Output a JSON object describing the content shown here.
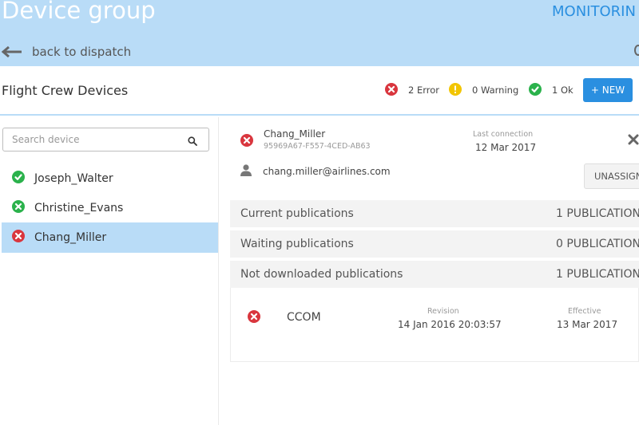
{
  "header": {
    "title": "Device group",
    "monitoring_label": "MONITORIN",
    "back_label": "back to dispatch"
  },
  "subheader": {
    "group_name": "Flight Crew Devices",
    "status": {
      "error_label": "2 Error",
      "warning_label": "0 Warning",
      "ok_label": "1 Ok"
    },
    "new_button_label": "+ NEW"
  },
  "search": {
    "placeholder": "Search device",
    "value": ""
  },
  "devices": [
    {
      "name": "Joseph_Walter",
      "status": "ok"
    },
    {
      "name": "Christine_Evans",
      "status": "ok"
    },
    {
      "name": "Chang_Miller",
      "status": "error"
    }
  ],
  "selected_device": {
    "name": "Chang_Miller",
    "id": "95969A67-F557-4CED-AB63",
    "last_connection_label": "Last connection",
    "last_connection": "12 Mar 2017",
    "email": "chang.miller@airlines.com",
    "unassign_label": "UNASSIGN"
  },
  "publications": {
    "current": {
      "label": "Current publications",
      "count": "1 PUBLICATION"
    },
    "waiting": {
      "label": "Waiting publications",
      "count": "0 PUBLICATION"
    },
    "not_downloaded": {
      "label": "Not downloaded publications",
      "count": "1 PUBLICATION"
    },
    "items": [
      {
        "name": "CCOM",
        "revision_label": "Revision",
        "revision": "14 Jan 2016 20:03:57",
        "effective_label": "Effective",
        "effective": "13 Mar 2017",
        "status": "error"
      }
    ]
  },
  "colors": {
    "header_bg": "#b9dcf7",
    "accent": "#2a8fe0",
    "error": "#d9363e",
    "warning": "#f2c500",
    "ok": "#2bb24c"
  }
}
